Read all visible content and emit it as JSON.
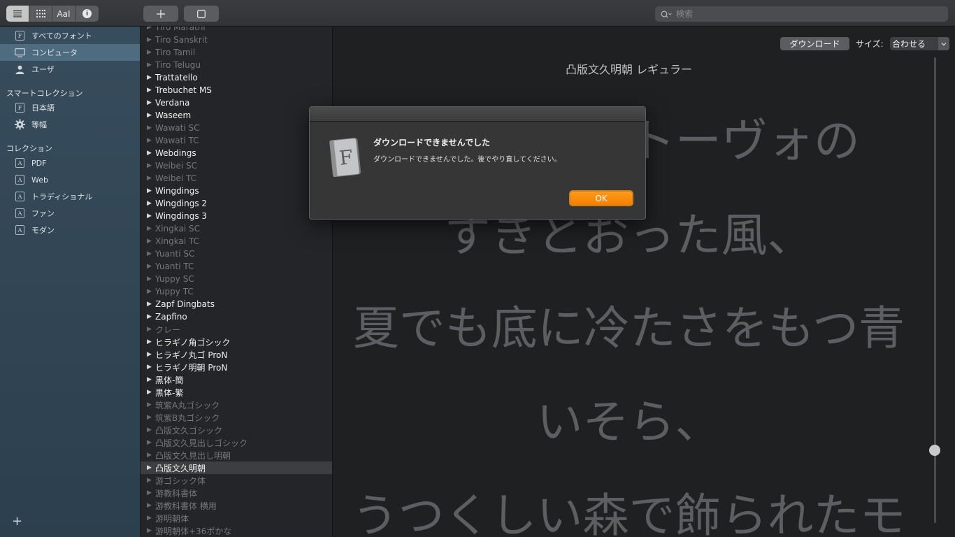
{
  "toolbar": {
    "view_buttons": [
      "list-icon",
      "grid-icon",
      "aa-icon",
      "info-icon"
    ],
    "aa_label": "AaI",
    "info_label": "i",
    "add_label": "+",
    "search_placeholder": "検索"
  },
  "sidebar": {
    "library_items": [
      {
        "label": "すべてのフォント",
        "icon": "font-book-icon"
      },
      {
        "label": "コンピュータ",
        "icon": "computer-icon",
        "selected": true
      },
      {
        "label": "ユーザ",
        "icon": "user-icon"
      }
    ],
    "smart_header": "スマートコレクション",
    "smart_items": [
      {
        "label": "日本語",
        "icon": "font-book-icon"
      },
      {
        "label": "等幅",
        "icon": "gear-icon"
      }
    ],
    "collection_header": "コレクション",
    "collection_items": [
      {
        "label": "PDF"
      },
      {
        "label": "Web"
      },
      {
        "label": "トラディショナル"
      },
      {
        "label": "ファン"
      },
      {
        "label": "モダン"
      }
    ],
    "add_label": "+"
  },
  "fonts": [
    {
      "name": "Tiro Marathi",
      "dim": true
    },
    {
      "name": "Tiro Sanskrit",
      "dim": true
    },
    {
      "name": "Tiro Tamil",
      "dim": true
    },
    {
      "name": "Tiro Telugu",
      "dim": true
    },
    {
      "name": "Trattatello",
      "dim": false
    },
    {
      "name": "Trebuchet MS",
      "dim": false
    },
    {
      "name": "Verdana",
      "dim": false
    },
    {
      "name": "Waseem",
      "dim": false
    },
    {
      "name": "Wawati SC",
      "dim": true
    },
    {
      "name": "Wawati TC",
      "dim": true
    },
    {
      "name": "Webdings",
      "dim": false
    },
    {
      "name": "Weibei SC",
      "dim": true
    },
    {
      "name": "Weibei TC",
      "dim": true
    },
    {
      "name": "Wingdings",
      "dim": false
    },
    {
      "name": "Wingdings 2",
      "dim": false
    },
    {
      "name": "Wingdings 3",
      "dim": false
    },
    {
      "name": "Xingkai SC",
      "dim": true
    },
    {
      "name": "Xingkai TC",
      "dim": true
    },
    {
      "name": "Yuanti SC",
      "dim": true
    },
    {
      "name": "Yuanti TC",
      "dim": true
    },
    {
      "name": "Yuppy SC",
      "dim": true
    },
    {
      "name": "Yuppy TC",
      "dim": true
    },
    {
      "name": "Zapf Dingbats",
      "dim": false
    },
    {
      "name": "Zapfino",
      "dim": false
    },
    {
      "name": "クレー",
      "dim": true
    },
    {
      "name": "ヒラギノ角ゴシック",
      "dim": false
    },
    {
      "name": "ヒラギノ丸ゴ ProN",
      "dim": false
    },
    {
      "name": "ヒラギノ明朝 ProN",
      "dim": false
    },
    {
      "name": "黒体-簡",
      "dim": false
    },
    {
      "name": "黒体-繁",
      "dim": false
    },
    {
      "name": "筑紫A丸ゴシック",
      "dim": true
    },
    {
      "name": "筑紫B丸ゴシック",
      "dim": true
    },
    {
      "name": "凸版文久ゴシック",
      "dim": true
    },
    {
      "name": "凸版文久見出しゴシック",
      "dim": true
    },
    {
      "name": "凸版文久見出し明朝",
      "dim": true
    },
    {
      "name": "凸版文久明朝",
      "dim": false,
      "selected": true
    },
    {
      "name": "游ゴシック体",
      "dim": true
    },
    {
      "name": "游教科書体",
      "dim": true
    },
    {
      "name": "游教科書体 横用",
      "dim": true
    },
    {
      "name": "游明朝体",
      "dim": true
    },
    {
      "name": "游明朝体+36ポかな",
      "dim": true
    }
  ],
  "preview": {
    "download_label": "ダウンロード",
    "size_label": "サイズ:",
    "size_value": "合わせる",
    "font_title": "凸版文久明朝 レギュラー",
    "sample_lines": [
      "あのイーハトーヴォの",
      "すきとおった風、",
      "夏でも底に冷たさをもつ青",
      "いそら、",
      "うつくしい森で飾られたモ"
    ],
    "size_slider_value": 0.85
  },
  "dialog": {
    "title": "ダウンロードできませんでした",
    "message": "ダウンロードできませんでした。後でやり直してください。",
    "ok_label": "OK",
    "icon_letter": "F"
  }
}
